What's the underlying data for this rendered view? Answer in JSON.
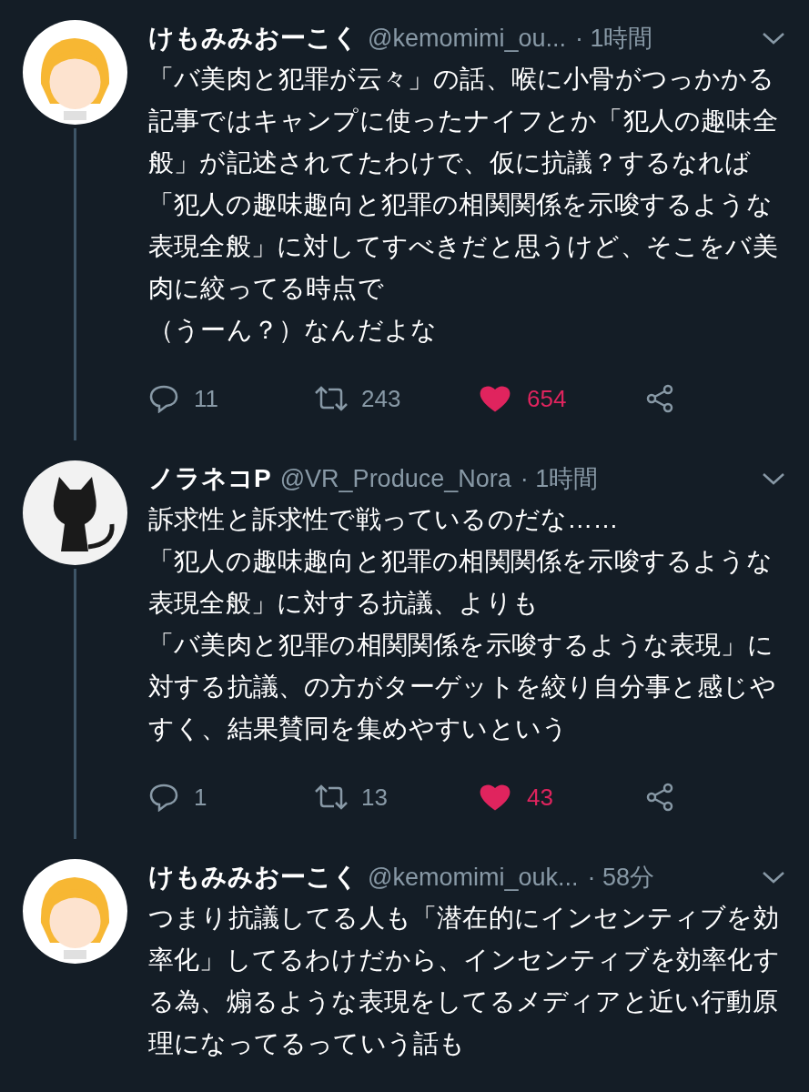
{
  "tweets": [
    {
      "avatar": {
        "kind": "girl"
      },
      "name": "けもみみおーこく",
      "handle": "@kemomimi_ou...",
      "time": "· 1時間",
      "paragraphs": [
        "「バ美肉と犯罪が云々」の話、喉に小骨がつっかかる",
        "記事ではキャンプに使ったナイフとか「犯人の趣味全般」が記述されてたわけで、仮に抗議？するなれば「犯人の趣味趣向と犯罪の相関関係を示唆するような表現全般」に対してすべきだと思うけど、そこをバ美肉に絞ってる時点で",
        "（うーん？）なんだよな"
      ],
      "replies": "11",
      "retweets": "243",
      "likes": "654",
      "liked": true
    },
    {
      "avatar": {
        "kind": "cat"
      },
      "name": "ノラネコP",
      "handle": "@VR_Produce_Nora",
      "time": "· 1時間",
      "paragraphs": [
        "訴求性と訴求性で戦っているのだな……",
        "「犯人の趣味趣向と犯罪の相関関係を示唆するような表現全般」に対する抗議、よりも",
        "「バ美肉と犯罪の相関関係を示唆するような表現」に対する抗議、の方がターゲットを絞り自分事と感じやすく、結果賛同を集めやすいという"
      ],
      "replies": "1",
      "retweets": "13",
      "likes": "43",
      "liked": true
    },
    {
      "avatar": {
        "kind": "girl"
      },
      "name": "けもみみおーこく",
      "handle": "@kemomimi_ouk...",
      "time": "· 58分",
      "paragraphs": [
        "つまり抗議してる人も「潜在的にインセンティブを効率化」してるわけだから、インセンティブを効率化する為、煽るような表現をしてるメディアと近い行動原理になってるっていう話も"
      ]
    }
  ]
}
